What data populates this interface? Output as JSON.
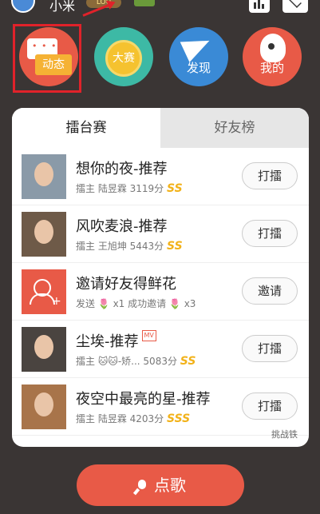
{
  "header": {
    "username": "小米",
    "badge": "LOU"
  },
  "nav": {
    "items": [
      {
        "label": "动态"
      },
      {
        "label": "大赛"
      },
      {
        "label": "发现"
      },
      {
        "label": "我的"
      }
    ]
  },
  "tabs": [
    {
      "label": "擂台赛",
      "active": true
    },
    {
      "label": "好友榜",
      "active": false
    }
  ],
  "rows": [
    {
      "title": "想你的夜-推荐",
      "sub": "擂主 陆昱霖 3119分",
      "grade": "SS",
      "button": "打擂"
    },
    {
      "title": "风吹麦浪-推荐",
      "sub": "擂主 王旭坤 5443分",
      "grade": "SS",
      "button": "打擂"
    },
    {
      "title": "邀请好友得鲜花",
      "sub": "发送 🌷 x1  成功邀请 🌷 x3",
      "grade": "",
      "button": "邀请"
    },
    {
      "title": "尘埃-推荐",
      "mv": "MV",
      "sub": "擂主 🐱🐱-矫... 5083分",
      "grade": "SS",
      "button": "打擂"
    },
    {
      "title": "夜空中最亮的星-推荐",
      "sub": "擂主 陆昱霖 4203分",
      "grade": "SSS",
      "button": "打擂"
    }
  ],
  "footer_note": "挑战铁",
  "main_button": "点歌"
}
